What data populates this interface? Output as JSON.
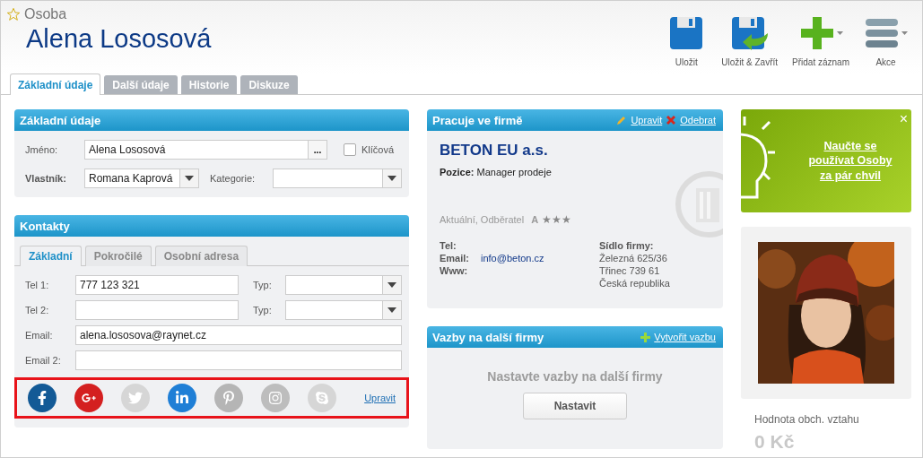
{
  "header": {
    "entity_type": "Osoba",
    "favorite": false,
    "name": "Alena Lososová"
  },
  "toolbar": [
    {
      "kind": "save",
      "label": "Uložit",
      "dropdown": false
    },
    {
      "kind": "save-close",
      "label": "Uložit & Zavřít",
      "dropdown": false
    },
    {
      "kind": "add",
      "label": "Přidat záznam",
      "dropdown": true
    },
    {
      "kind": "menu",
      "label": "Akce",
      "dropdown": true
    }
  ],
  "tabs": [
    {
      "label": "Základní údaje",
      "selected": true
    },
    {
      "label": "Další údaje",
      "selected": false
    },
    {
      "label": "Historie",
      "selected": false
    },
    {
      "label": "Diskuze",
      "selected": false
    }
  ],
  "basic": {
    "title": "Základní údaje",
    "name_label": "Jméno:",
    "name_value": "Alena Lososová",
    "browse_button": "...",
    "key_label": "Klíčová",
    "key_checked": false,
    "owner_label": "Vlastník:",
    "owner_value": "Romana Kaprová",
    "category_label": "Kategorie:"
  },
  "contacts": {
    "title": "Kontakty",
    "tabs": [
      {
        "label": "Základní",
        "selected": true
      },
      {
        "label": "Pokročilé",
        "selected": false
      },
      {
        "label": "Osobní adresa",
        "selected": false
      }
    ],
    "fields": [
      {
        "kind": "phone",
        "label": "Tel 1:",
        "value": "777 123 321",
        "type_label": "Typ:"
      },
      {
        "kind": "phone",
        "label": "Tel 2:",
        "type_label": "Typ:"
      },
      {
        "kind": "text",
        "label": "Email:",
        "value": "alena.lososova@raynet.cz"
      },
      {
        "kind": "text",
        "label": "Email 2:"
      }
    ],
    "social_highlighted": true,
    "social": [
      {
        "kind": "facebook",
        "color": "#135a96"
      },
      {
        "kind": "googleplus",
        "color": "#d42020"
      },
      {
        "kind": "twitter",
        "color": "#d6d6d6"
      },
      {
        "kind": "linkedin",
        "color": "#1f7fd6"
      },
      {
        "kind": "pinterest",
        "color": "#b5b5b5"
      },
      {
        "kind": "instagram",
        "color": "#bdbdbd"
      },
      {
        "kind": "skype",
        "color": "#d6d6d6"
      }
    ],
    "edit_link": "Upravit"
  },
  "company": {
    "title": "Pracuje ve firmě",
    "actions": [
      {
        "kind": "edit",
        "label": "Upravit"
      },
      {
        "kind": "remove",
        "label": "Odebrat"
      }
    ],
    "name": "BETON EU a.s.",
    "position_label": "Pozice:",
    "position": "Manager prodeje",
    "status": "Aktuální, Odběratel",
    "rating_class": "A",
    "stars": 3,
    "contacts": [
      {
        "label": "Tel:"
      },
      {
        "label": "Email:",
        "value": "info@beton.cz"
      },
      {
        "label": "Www:"
      }
    ],
    "address_label": "Sídlo firmy:",
    "address": [
      "Železná 625/36",
      "Třinec 739 61",
      "Česká republika"
    ]
  },
  "relations": {
    "title": "Vazby na další firmy",
    "action": "Vytvořit vazbu",
    "empty": "Nastavte vazby na další firmy",
    "button": "Nastavit"
  },
  "tip": {
    "text": "Naučte se používat Osoby za pár chvil",
    "close": "×"
  },
  "value": {
    "label": "Hodnota obch. vztahu",
    "amount": "0 Kč"
  }
}
